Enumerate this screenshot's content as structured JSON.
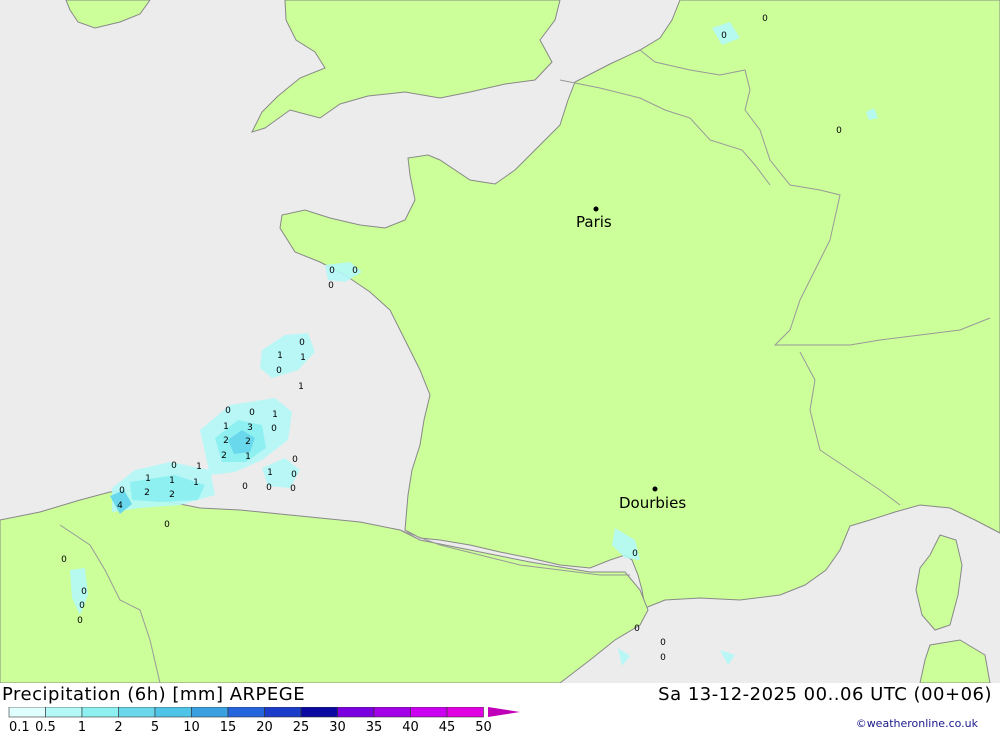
{
  "map": {
    "colors": {
      "land": "#ccff99",
      "sea": "#ececec",
      "border": "#999999",
      "coast": "#888888"
    },
    "cities": [
      {
        "name": "Paris"
      },
      {
        "name": "Dourbies"
      }
    ],
    "grid_values": [
      "0",
      "0",
      "0",
      "0",
      "0",
      "0",
      "0",
      "1",
      "1",
      "0",
      "1",
      "0",
      "0",
      "1",
      "1",
      "3",
      "0",
      "2",
      "2",
      "2",
      "1",
      "0",
      "1",
      "0",
      "1",
      "0",
      "1",
      "1",
      "2",
      "2",
      "1",
      "0",
      "0",
      "0",
      "4",
      "0",
      "0",
      "0",
      "0",
      "0",
      "0",
      "0",
      "0",
      "0",
      "0"
    ]
  },
  "footer": {
    "title_left": "Precipitation (6h) [mm] ARPEGE",
    "title_right": "Sa 13-12-2025 00..06 UTC (00+06)",
    "credit": "©weatheronline.co.uk"
  },
  "legend": {
    "labels": [
      "0.1",
      "0.5",
      "1",
      "2",
      "5",
      "10",
      "15",
      "20",
      "25",
      "30",
      "35",
      "40",
      "45",
      "50"
    ],
    "colors": [
      "#e0ffff",
      "#b4f8f8",
      "#8ef0f0",
      "#6ad8ec",
      "#50c4e6",
      "#3aa0e0",
      "#2464dc",
      "#1a3cc8",
      "#0a0aa0",
      "#7a00e0",
      "#a400e8",
      "#cc00f0",
      "#e000e0",
      "#c000b8"
    ]
  }
}
